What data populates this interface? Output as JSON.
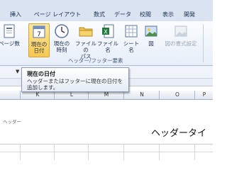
{
  "tabs": [
    {
      "label": "挿入",
      "active": false
    },
    {
      "label": "ページ レイアウト",
      "active": false
    },
    {
      "label": "数式",
      "active": false
    },
    {
      "label": "データ",
      "active": false
    },
    {
      "label": "校閲",
      "active": false
    },
    {
      "label": "表示",
      "active": false
    },
    {
      "label": "開発",
      "active": false
    }
  ],
  "ribbon": {
    "buttons": [
      {
        "id": "page_number",
        "label": "ページ数",
        "icon": "page-number-icon"
      },
      {
        "id": "current_date",
        "label": "現在の\n日付",
        "icon": "calendar-icon",
        "selected": true
      },
      {
        "id": "current_time",
        "label": "現在の\n時刻",
        "icon": "clock-icon"
      },
      {
        "id": "file_path",
        "label": "ファイルの\nパス",
        "icon": "folder-icon"
      },
      {
        "id": "file_name",
        "label": "ファイル名",
        "icon": "excel-file-icon"
      },
      {
        "id": "sheet_name",
        "label": "シート名",
        "icon": "sheet-icon"
      },
      {
        "id": "picture",
        "label": "図",
        "icon": "picture-icon"
      },
      {
        "id": "format_picture",
        "label": "図の書式設定",
        "icon": "format-picture-icon",
        "disabled": true
      }
    ],
    "group_label": "ヘッダー/フッター要素"
  },
  "tooltip": {
    "title": "現在の日付",
    "description": "ヘッダーまたはフッターに現在の日付を追加します。"
  },
  "columns": [
    "K",
    "L",
    "M",
    "N",
    "O",
    "P"
  ],
  "page": {
    "header_label": "ヘッダー",
    "header_text": "ヘッダータイ"
  },
  "colors": {
    "accent": "#f7c84f",
    "tab_bg": "#d9e3f1"
  }
}
